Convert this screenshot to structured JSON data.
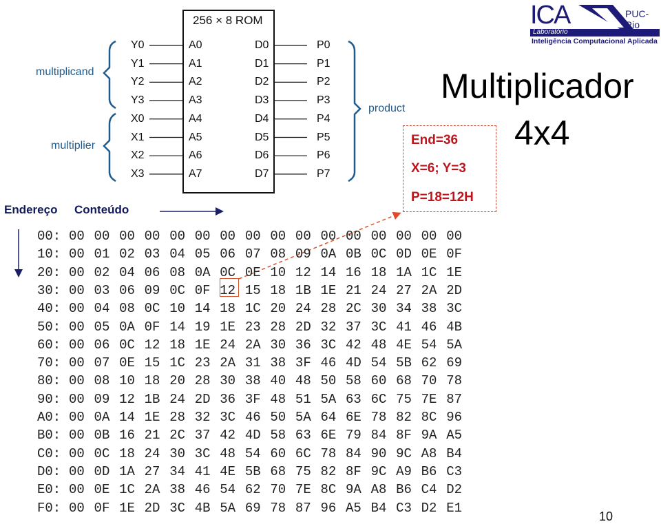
{
  "logo": {
    "mark": "ICA",
    "institution": "PUC-Rio",
    "lab_label": "Laboratório",
    "lab_name": "Inteligência Computacional Aplicada"
  },
  "slide": {
    "title_line1": "Multiplicador",
    "title_line2": "4x4",
    "page_number": "10"
  },
  "rom_diagram": {
    "title": "256 × 8 ROM",
    "inputs": [
      "Y0",
      "Y1",
      "Y2",
      "Y3",
      "X0",
      "X1",
      "X2",
      "X3"
    ],
    "address_pins": [
      "A0",
      "A1",
      "A2",
      "A3",
      "A4",
      "A5",
      "A6",
      "A7"
    ],
    "data_pins": [
      "D0",
      "D1",
      "D2",
      "D3",
      "D4",
      "D5",
      "D6",
      "D7"
    ],
    "outputs": [
      "P0",
      "P1",
      "P2",
      "P3",
      "P4",
      "P5",
      "P6",
      "P7"
    ],
    "brace_labels": {
      "multiplicand": "multiplicand",
      "multiplier": "multiplier",
      "product": "product"
    },
    "brace_color": "#1f5a8c"
  },
  "callout": {
    "lines": [
      "End=36",
      "X=6; Y=3",
      "P=18=12H"
    ],
    "color": "#c0141c"
  },
  "axis_labels": {
    "address": "Endereço",
    "content": "Conteúdo"
  },
  "hex_table": {
    "highlight": {
      "row": 3,
      "col": 6,
      "value": "12"
    },
    "rows": [
      {
        "addr": "00:",
        "cells": [
          "00",
          "00",
          "00",
          "00",
          "00",
          "00",
          "00",
          "00",
          "00",
          "00",
          "00",
          "00",
          "00",
          "00",
          "00",
          "00"
        ]
      },
      {
        "addr": "10:",
        "cells": [
          "00",
          "01",
          "02",
          "03",
          "04",
          "05",
          "06",
          "07",
          "08",
          "09",
          "0A",
          "0B",
          "0C",
          "0D",
          "0E",
          "0F"
        ]
      },
      {
        "addr": "20:",
        "cells": [
          "00",
          "02",
          "04",
          "06",
          "08",
          "0A",
          "0C",
          "0E",
          "10",
          "12",
          "14",
          "16",
          "18",
          "1A",
          "1C",
          "1E"
        ]
      },
      {
        "addr": "30:",
        "cells": [
          "00",
          "03",
          "06",
          "09",
          "0C",
          "0F",
          "12",
          "15",
          "18",
          "1B",
          "1E",
          "21",
          "24",
          "27",
          "2A",
          "2D"
        ]
      },
      {
        "addr": "40:",
        "cells": [
          "00",
          "04",
          "08",
          "0C",
          "10",
          "14",
          "18",
          "1C",
          "20",
          "24",
          "28",
          "2C",
          "30",
          "34",
          "38",
          "3C"
        ]
      },
      {
        "addr": "50:",
        "cells": [
          "00",
          "05",
          "0A",
          "0F",
          "14",
          "19",
          "1E",
          "23",
          "28",
          "2D",
          "32",
          "37",
          "3C",
          "41",
          "46",
          "4B"
        ]
      },
      {
        "addr": "60:",
        "cells": [
          "00",
          "06",
          "0C",
          "12",
          "18",
          "1E",
          "24",
          "2A",
          "30",
          "36",
          "3C",
          "42",
          "48",
          "4E",
          "54",
          "5A"
        ]
      },
      {
        "addr": "70:",
        "cells": [
          "00",
          "07",
          "0E",
          "15",
          "1C",
          "23",
          "2A",
          "31",
          "38",
          "3F",
          "46",
          "4D",
          "54",
          "5B",
          "62",
          "69"
        ]
      },
      {
        "addr": "80:",
        "cells": [
          "00",
          "08",
          "10",
          "18",
          "20",
          "28",
          "30",
          "38",
          "40",
          "48",
          "50",
          "58",
          "60",
          "68",
          "70",
          "78"
        ]
      },
      {
        "addr": "90:",
        "cells": [
          "00",
          "09",
          "12",
          "1B",
          "24",
          "2D",
          "36",
          "3F",
          "48",
          "51",
          "5A",
          "63",
          "6C",
          "75",
          "7E",
          "87"
        ]
      },
      {
        "addr": "A0:",
        "cells": [
          "00",
          "0A",
          "14",
          "1E",
          "28",
          "32",
          "3C",
          "46",
          "50",
          "5A",
          "64",
          "6E",
          "78",
          "82",
          "8C",
          "96"
        ]
      },
      {
        "addr": "B0:",
        "cells": [
          "00",
          "0B",
          "16",
          "21",
          "2C",
          "37",
          "42",
          "4D",
          "58",
          "63",
          "6E",
          "79",
          "84",
          "8F",
          "9A",
          "A5"
        ]
      },
      {
        "addr": "C0:",
        "cells": [
          "00",
          "0C",
          "18",
          "24",
          "30",
          "3C",
          "48",
          "54",
          "60",
          "6C",
          "78",
          "84",
          "90",
          "9C",
          "A8",
          "B4"
        ]
      },
      {
        "addr": "D0:",
        "cells": [
          "00",
          "0D",
          "1A",
          "27",
          "34",
          "41",
          "4E",
          "5B",
          "68",
          "75",
          "82",
          "8F",
          "9C",
          "A9",
          "B6",
          "C3"
        ]
      },
      {
        "addr": "E0:",
        "cells": [
          "00",
          "0E",
          "1C",
          "2A",
          "38",
          "46",
          "54",
          "62",
          "70",
          "7E",
          "8C",
          "9A",
          "A8",
          "B6",
          "C4",
          "D2"
        ]
      },
      {
        "addr": "F0:",
        "cells": [
          "00",
          "0F",
          "1E",
          "2D",
          "3C",
          "4B",
          "5A",
          "69",
          "78",
          "87",
          "96",
          "A5",
          "B4",
          "C3",
          "D2",
          "E1"
        ]
      }
    ]
  }
}
